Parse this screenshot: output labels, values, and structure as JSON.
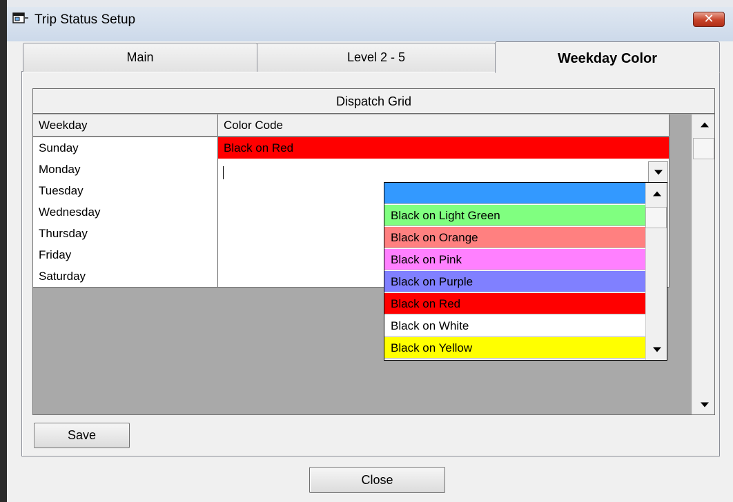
{
  "window": {
    "title": "Trip Status Setup",
    "close_glyph": "✕",
    "icon": "app-window-icon"
  },
  "tabs": [
    {
      "label": "Main",
      "selected": false
    },
    {
      "label": "Level 2 - 5",
      "selected": false
    },
    {
      "label": "Weekday Color",
      "selected": true
    }
  ],
  "grid": {
    "caption": "Dispatch Grid",
    "columns": [
      "Weekday",
      "Color Code"
    ],
    "rows": [
      {
        "weekday": "Sunday",
        "color_code": "Black on Red",
        "bg": "#ff0000"
      },
      {
        "weekday": "Monday",
        "color_code": "",
        "editing": true
      },
      {
        "weekday": "Tuesday",
        "color_code": ""
      },
      {
        "weekday": "Wednesday",
        "color_code": ""
      },
      {
        "weekday": "Thursday",
        "color_code": ""
      },
      {
        "weekday": "Friday",
        "color_code": ""
      },
      {
        "weekday": "Saturday",
        "color_code": ""
      }
    ]
  },
  "dropdown": {
    "options": [
      {
        "label": "",
        "bg": "#3399ff"
      },
      {
        "label": "Black on Light Green",
        "bg": "#80ff80"
      },
      {
        "label": "Black on Orange",
        "bg": "#ff8080"
      },
      {
        "label": "Black on Pink",
        "bg": "#ff80ff"
      },
      {
        "label": "Black on Purple",
        "bg": "#8080ff"
      },
      {
        "label": "Black on Red",
        "bg": "#ff0000"
      },
      {
        "label": "Black on White",
        "bg": "#ffffff"
      },
      {
        "label": "Black on Yellow",
        "bg": "#ffff00"
      }
    ]
  },
  "buttons": {
    "save": "Save",
    "close": "Close"
  }
}
